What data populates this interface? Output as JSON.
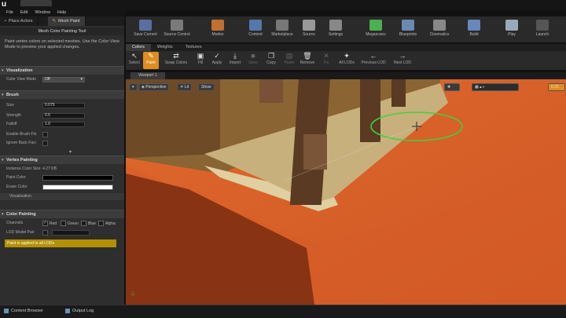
{
  "window": {
    "tab_title": ""
  },
  "menu": [
    "File",
    "Edit",
    "Window",
    "Help"
  ],
  "modes": {
    "place_actors": "Place Actors",
    "mesh_paint": "Mesh Paint"
  },
  "tool": {
    "title": "Mesh Color Painting Tool",
    "description": "Paint vertex colors on selected meshes. Use the Color View Mode to preview your applied changes."
  },
  "visualization": {
    "header": "Visualization",
    "color_view_mode_label": "Color View Mode",
    "color_view_mode_value": "Off"
  },
  "brush": {
    "header": "Brush",
    "size_label": "Size",
    "size_value": "0.075",
    "strength_label": "Strength",
    "strength_value": "0.5",
    "falloff_label": "Falloff",
    "falloff_value": "1.0",
    "enable_flow_label": "Enable Brush Flo",
    "ignore_back_label": "Ignore Back-Faci"
  },
  "vertex_painting": {
    "header": "Vertex Painting",
    "instance_size": "Instance Color Size: 4.27 KB",
    "paint_color_label": "Paint Color",
    "paint_color": "#000000",
    "erase_color_label": "Erase Color",
    "erase_color": "#ffffff",
    "visualization_label": "Visualization"
  },
  "color_painting": {
    "header": "Color Painting",
    "channels_label": "Channels",
    "channels": [
      {
        "label": "Red",
        "checked": true
      },
      {
        "label": "Green",
        "checked": false
      },
      {
        "label": "Blue",
        "checked": false
      },
      {
        "label": "Alpha",
        "checked": false
      }
    ],
    "lod_label": "LOD Model Pair",
    "warning": "Paint is applied to all LODs"
  },
  "toolbar": [
    {
      "label": "Save Current",
      "icon": "save-icon",
      "color": "#5a6fa0"
    },
    {
      "label": "Source Control",
      "icon": "source-control-icon",
      "color": "#7a7a7a"
    },
    {
      "label": "Modes",
      "icon": "modes-icon",
      "color": "#c07030"
    },
    {
      "label": "Content",
      "icon": "content-icon",
      "color": "#5577aa"
    },
    {
      "label": "Marketplace",
      "icon": "marketplace-icon",
      "color": "#777"
    },
    {
      "label": "Source",
      "icon": "source-icon",
      "color": "#999"
    },
    {
      "label": "Settings",
      "icon": "settings-icon",
      "color": "#888"
    },
    {
      "label": "Megascans",
      "icon": "megascans-icon",
      "color": "#4caf50"
    },
    {
      "label": "Blueprints",
      "icon": "blueprints-icon",
      "color": "#6a8ab0"
    },
    {
      "label": "Cinematics",
      "icon": "cinematics-icon",
      "color": "#888"
    },
    {
      "label": "Build",
      "icon": "build-icon",
      "color": "#6688bb"
    },
    {
      "label": "Play",
      "icon": "play-icon",
      "color": "#9ab"
    },
    {
      "label": "Launch",
      "icon": "launch-icon",
      "color": "#555"
    }
  ],
  "paint_tabs": [
    "Colors",
    "Weights",
    "Textures"
  ],
  "paint_tools": [
    {
      "label": "Select",
      "glyph": "↖",
      "state": "normal"
    },
    {
      "label": "Paint",
      "glyph": "✎",
      "state": "active"
    },
    {
      "label": "Swap Colors",
      "glyph": "⇄",
      "state": "normal"
    },
    {
      "label": "Fill",
      "glyph": "▣",
      "state": "normal"
    },
    {
      "label": "Apply",
      "glyph": "✓",
      "state": "normal"
    },
    {
      "label": "Import",
      "glyph": "⤓",
      "state": "normal"
    },
    {
      "label": "Save",
      "glyph": "■",
      "state": "disabled"
    },
    {
      "label": "Copy",
      "glyph": "❐",
      "state": "normal"
    },
    {
      "label": "Paste",
      "glyph": "▤",
      "state": "disabled"
    },
    {
      "label": "Remove",
      "glyph": "🗑",
      "state": "normal"
    },
    {
      "label": "Fix",
      "glyph": "✕",
      "state": "disabled"
    },
    {
      "label": "All LODs",
      "glyph": "✦",
      "state": "normal"
    },
    {
      "label": "Previous LOD",
      "glyph": "←",
      "state": "normal"
    },
    {
      "label": "Next LOD",
      "glyph": "→",
      "state": "normal"
    }
  ],
  "viewport": {
    "tab": "Viewport 1",
    "perspective": "Perspective",
    "lit": "Lit",
    "show": "Show",
    "grid_value": "0.25"
  },
  "bottom_tabs": [
    "Content Browser",
    "Output Log"
  ],
  "colors": {
    "accent": "#e08c20",
    "warning": "#b39000",
    "brush_ring": "#3fd23f",
    "sand": "#d8622a"
  }
}
